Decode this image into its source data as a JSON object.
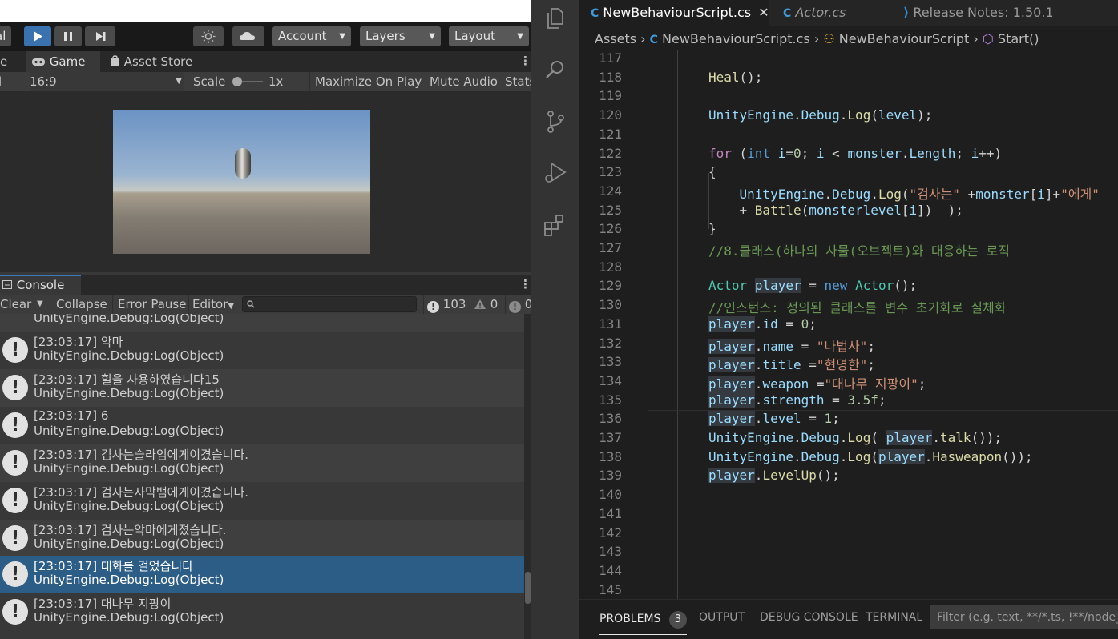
{
  "unity": {
    "toolbar": {
      "left_fragment": "al",
      "account": "Account",
      "layers": "Layers",
      "layout": "Layout"
    },
    "tabs": {
      "scene_fragment": "e",
      "game": "Game",
      "asset_store": "Asset Store"
    },
    "game_bar": {
      "display_fragment": "l",
      "aspect": "16:9",
      "scale_label": "Scale",
      "scale_value": "1x",
      "maximize": "Maximize On Play",
      "mute": "Mute Audio",
      "stats": "Stats"
    },
    "console": {
      "tab_label": "Console",
      "clear": "Clear",
      "collapse": "Collapse",
      "error_pause": "Error Pause",
      "editor": "Editor",
      "search_placeholder": "",
      "count_log": "103",
      "count_warn": "0",
      "count_error": "0",
      "partial_top": "UnityEngine.Debug:Log(Object)",
      "entries": [
        {
          "message": "[23:03:17] 악마",
          "source": "UnityEngine.Debug:Log(Object)"
        },
        {
          "message": "[23:03:17] 힐을 사용하였습니다15",
          "source": "UnityEngine.Debug:Log(Object)"
        },
        {
          "message": "[23:03:17] 6",
          "source": "UnityEngine.Debug:Log(Object)"
        },
        {
          "message": "[23:03:17] 검사는슬라임에게이겼습니다.",
          "source": "UnityEngine.Debug:Log(Object)"
        },
        {
          "message": "[23:03:17] 검사는사막뱀에게이겼습니다.",
          "source": "UnityEngine.Debug:Log(Object)"
        },
        {
          "message": "[23:03:17] 검사는악마에게졌습니다.",
          "source": "UnityEngine.Debug:Log(Object)"
        },
        {
          "message": "[23:03:17] 대화를 걸었습니다",
          "source": "UnityEngine.Debug:Log(Object)"
        },
        {
          "message": "[23:03:17] 대나무 지팡이",
          "source": "UnityEngine.Debug:Log(Object)"
        }
      ],
      "selected_index": 6
    }
  },
  "vscode": {
    "tabs": [
      {
        "label": "NewBehaviourScript.cs",
        "active": true
      },
      {
        "label": "Actor.cs",
        "active": false
      },
      {
        "label": "Release Notes: 1.50.1",
        "active": false
      }
    ],
    "breadcrumb": {
      "root": "Assets",
      "file": "NewBehaviourScript.cs",
      "class": "NewBehaviourScript",
      "method": "Start()"
    },
    "code": [
      {
        "num": "117",
        "text": ""
      },
      {
        "num": "118",
        "text": "Heal();"
      },
      {
        "num": "119",
        "text": ""
      },
      {
        "num": "120",
        "text": "UnityEngine.Debug.Log(level);"
      },
      {
        "num": "121",
        "text": ""
      },
      {
        "num": "122",
        "text": "for (int i=0; i < monster.Length; i++)"
      },
      {
        "num": "123",
        "text": "{"
      },
      {
        "num": "124",
        "text": "    UnityEngine.Debug.Log(\"검사는\" +monster[i]+\"에게\""
      },
      {
        "num": "125",
        "text": "    + Battle(monsterlevel[i])  );"
      },
      {
        "num": "126",
        "text": "}"
      },
      {
        "num": "127",
        "text": "//8.클래스(하나의 사물(오브젝트)와 대응하는 로직"
      },
      {
        "num": "128",
        "text": ""
      },
      {
        "num": "129",
        "text": "Actor player = new Actor();"
      },
      {
        "num": "130",
        "text": "//인스턴스: 정의된 클래스를 변수 초기화로 실체화"
      },
      {
        "num": "131",
        "text": "player.id = 0;"
      },
      {
        "num": "132",
        "text": "player.name = \"나법사\";"
      },
      {
        "num": "133",
        "text": "player.title =\"현명한\";"
      },
      {
        "num": "134",
        "text": "player.weapon =\"대나무 지팡이\";"
      },
      {
        "num": "135",
        "text": "player.strength = 3.5f;"
      },
      {
        "num": "136",
        "text": "player.level = 1;"
      },
      {
        "num": "137",
        "text": "UnityEngine.Debug.Log( player.talk());"
      },
      {
        "num": "138",
        "text": "UnityEngine.Debug.Log(player.Hasweapon());"
      },
      {
        "num": "139",
        "text": "player.LevelUp();"
      },
      {
        "num": "140",
        "text": ""
      },
      {
        "num": "141",
        "text": ""
      },
      {
        "num": "142",
        "text": ""
      },
      {
        "num": "143",
        "text": ""
      },
      {
        "num": "144",
        "text": ""
      },
      {
        "num": "145",
        "text": ""
      }
    ],
    "panel": {
      "problems": "PROBLEMS",
      "problems_count": "3",
      "output": "OUTPUT",
      "debug_console": "DEBUG CONSOLE",
      "terminal": "TERMINAL",
      "filter_placeholder": "Filter (e.g. text, **/*.ts, !**/node_m"
    }
  }
}
